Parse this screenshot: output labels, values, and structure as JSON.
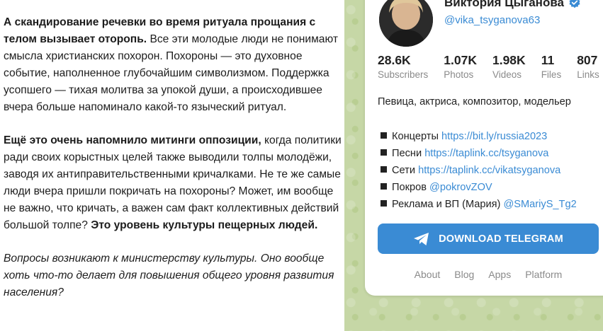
{
  "article": {
    "p1_bold": "А скандирование речевки во время ритуала прощания с телом вызывает оторопь.",
    "p1_rest": " Все эти молодые люди не понимают смысла христианских похорон. Похороны — это духовное событие, наполненное глубочайшим символизмом. Поддержка усопшего — тихая молитва за упокой души, а происходившее вчера больше напоминало какой-то языческий ритуал.",
    "p2_bold": "Ещё это очень напомнило митинги оппозиции,",
    "p2_rest": " когда политики ради своих корыстных целей также выводили толпы молодёжи, заводя их антиправительственными кричалками. Не те же самые люди вчера пришли покричать на похороны? Может, им вообще не важно, что кричать, а важен сам факт коллективных действий большой толпе? ",
    "p2_bold_end": "Это уровень культуры пещерных людей.",
    "p3_italic": "Вопросы возникают к министерству культуры. Оно вообще хоть что-то делает для повышения общего уровня развития населения?"
  },
  "channel": {
    "name": "Виктория Цыганова",
    "username": "@vika_tsyganova63",
    "stats": [
      {
        "value": "28.6K",
        "label": "Subscribers"
      },
      {
        "value": "1.07K",
        "label": "Photos"
      },
      {
        "value": "1.98K",
        "label": "Videos"
      },
      {
        "value": "11",
        "label": "Files"
      },
      {
        "value": "807",
        "label": "Links"
      }
    ],
    "description": "Певица, актриса, композитор, модельер",
    "links": [
      {
        "label": "Концерты",
        "url": "https://bit.ly/russia2023"
      },
      {
        "label": "Песни",
        "url": "https://taplink.cc/tsyganova"
      },
      {
        "label": "Сети",
        "url": "https://taplink.cc/vikatsyganova"
      },
      {
        "label": "Покров",
        "url": "@pokrovZOV"
      },
      {
        "label": "Реклама и ВП (Мария)",
        "url": "@SMariyS_Tg2"
      }
    ],
    "download_label": "DOWNLOAD TELEGRAM",
    "footer": [
      "About",
      "Blog",
      "Apps",
      "Platform"
    ]
  },
  "colors": {
    "accent": "#3a8bd4",
    "panel_bg": "#c6d7a6"
  },
  "icons": [
    "verified-badge-icon",
    "telegram-plane-icon",
    "bullet-square-icon"
  ]
}
